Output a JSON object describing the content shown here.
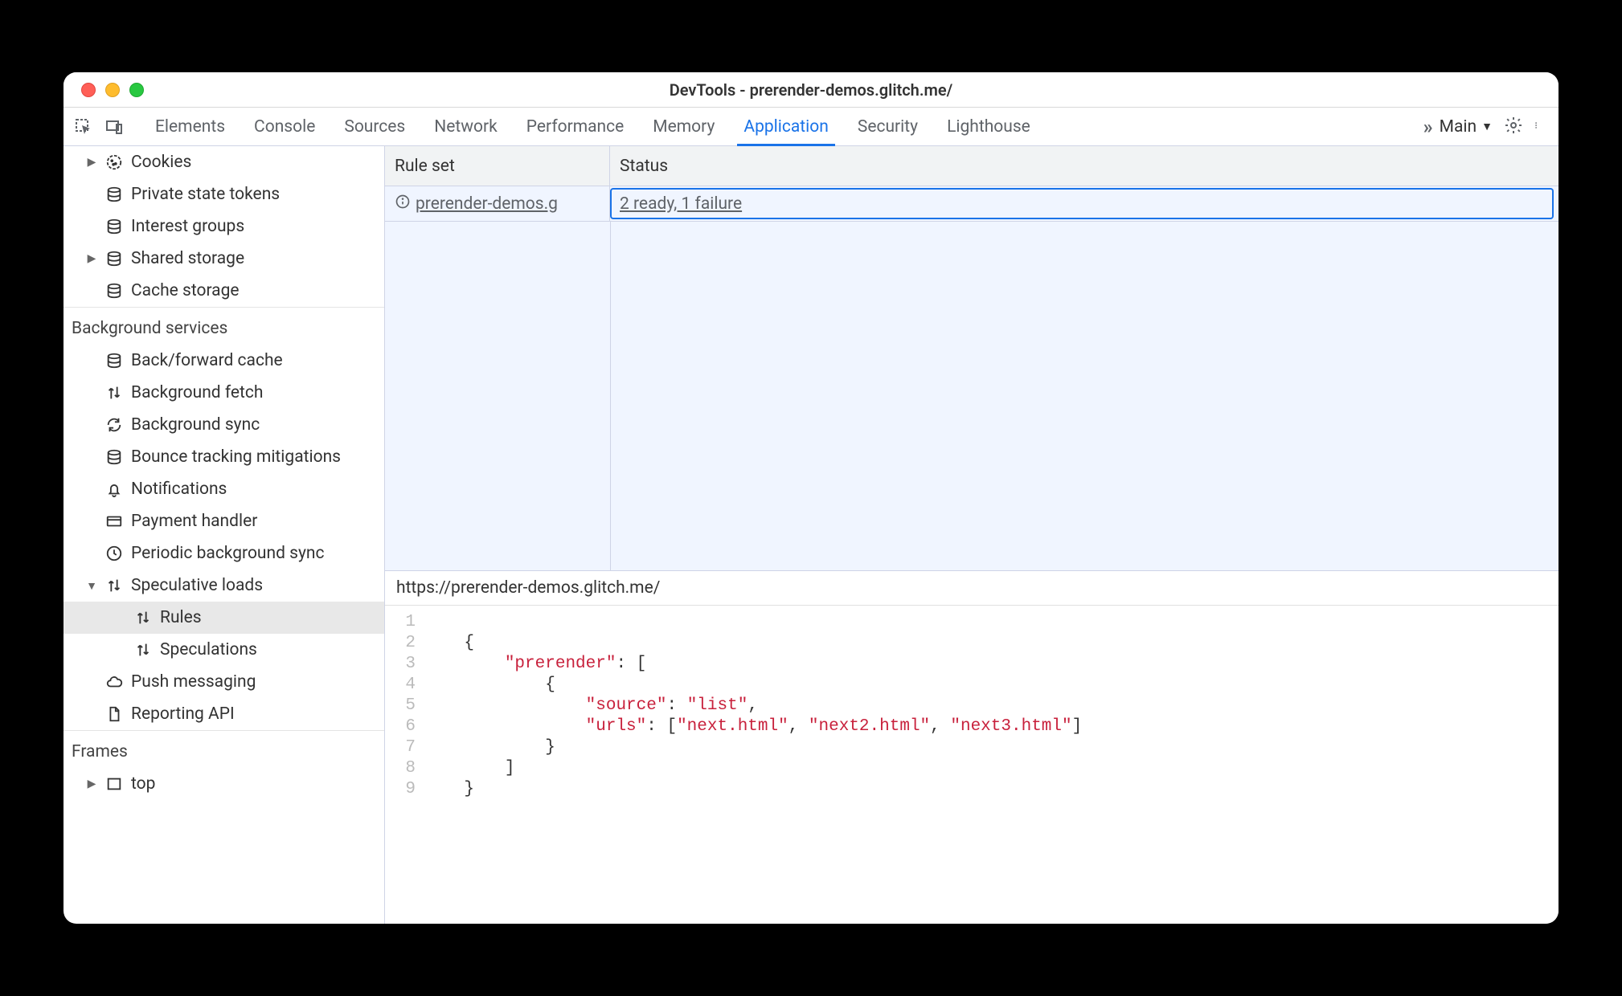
{
  "title": "DevTools - prerender-demos.glitch.me/",
  "tabs": [
    "Elements",
    "Console",
    "Sources",
    "Network",
    "Performance",
    "Memory",
    "Application",
    "Security",
    "Lighthouse"
  ],
  "active_tab": "Application",
  "frame_selector": "Main",
  "sidebar": {
    "storage_items": [
      {
        "label": "Cookies",
        "icon": "cookie",
        "expandable": true
      },
      {
        "label": "Private state tokens",
        "icon": "db"
      },
      {
        "label": "Interest groups",
        "icon": "db"
      },
      {
        "label": "Shared storage",
        "icon": "db",
        "expandable": true
      },
      {
        "label": "Cache storage",
        "icon": "db"
      }
    ],
    "bg_section": "Background services",
    "bg_items": [
      {
        "label": "Back/forward cache",
        "icon": "db"
      },
      {
        "label": "Background fetch",
        "icon": "updown"
      },
      {
        "label": "Background sync",
        "icon": "sync"
      },
      {
        "label": "Bounce tracking mitigations",
        "icon": "db"
      },
      {
        "label": "Notifications",
        "icon": "bell"
      },
      {
        "label": "Payment handler",
        "icon": "card"
      },
      {
        "label": "Periodic background sync",
        "icon": "clock"
      },
      {
        "label": "Speculative loads",
        "icon": "updown",
        "expandable": true,
        "expanded": true,
        "children": [
          {
            "label": "Rules",
            "selected": true
          },
          {
            "label": "Speculations"
          }
        ]
      },
      {
        "label": "Push messaging",
        "icon": "cloud"
      },
      {
        "label": "Reporting API",
        "icon": "doc"
      }
    ],
    "frames_section": "Frames",
    "frames_items": [
      {
        "label": "top",
        "icon": "frame",
        "expandable": true
      }
    ]
  },
  "grid": {
    "columns": {
      "ruleset": "Rule set",
      "status": "Status"
    },
    "rows": [
      {
        "ruleset": "prerender-demos.g",
        "status": "2 ready, 1 failure"
      }
    ],
    "detail_url": "https://prerender-demos.glitch.me/"
  },
  "code": {
    "line_count": 9,
    "lines": [
      {
        "n": 1,
        "indent": 0,
        "tokens": []
      },
      {
        "n": 2,
        "indent": 1,
        "tokens": [
          {
            "t": "{",
            "c": "pun"
          }
        ]
      },
      {
        "n": 3,
        "indent": 2,
        "tokens": [
          {
            "t": "\"prerender\"",
            "c": "key"
          },
          {
            "t": ": [",
            "c": "pun"
          }
        ]
      },
      {
        "n": 4,
        "indent": 3,
        "tokens": [
          {
            "t": "{",
            "c": "pun"
          }
        ]
      },
      {
        "n": 5,
        "indent": 4,
        "tokens": [
          {
            "t": "\"source\"",
            "c": "key"
          },
          {
            "t": ": ",
            "c": "pun"
          },
          {
            "t": "\"list\"",
            "c": "str"
          },
          {
            "t": ",",
            "c": "pun"
          }
        ]
      },
      {
        "n": 6,
        "indent": 4,
        "tokens": [
          {
            "t": "\"urls\"",
            "c": "key"
          },
          {
            "t": ": [",
            "c": "pun"
          },
          {
            "t": "\"next.html\"",
            "c": "str"
          },
          {
            "t": ", ",
            "c": "pun"
          },
          {
            "t": "\"next2.html\"",
            "c": "str"
          },
          {
            "t": ", ",
            "c": "pun"
          },
          {
            "t": "\"next3.html\"",
            "c": "str"
          },
          {
            "t": "]",
            "c": "pun"
          }
        ]
      },
      {
        "n": 7,
        "indent": 3,
        "tokens": [
          {
            "t": "}",
            "c": "pun"
          }
        ]
      },
      {
        "n": 8,
        "indent": 2,
        "tokens": [
          {
            "t": "]",
            "c": "pun"
          }
        ]
      },
      {
        "n": 9,
        "indent": 1,
        "tokens": [
          {
            "t": "}",
            "c": "pun"
          }
        ]
      }
    ]
  }
}
